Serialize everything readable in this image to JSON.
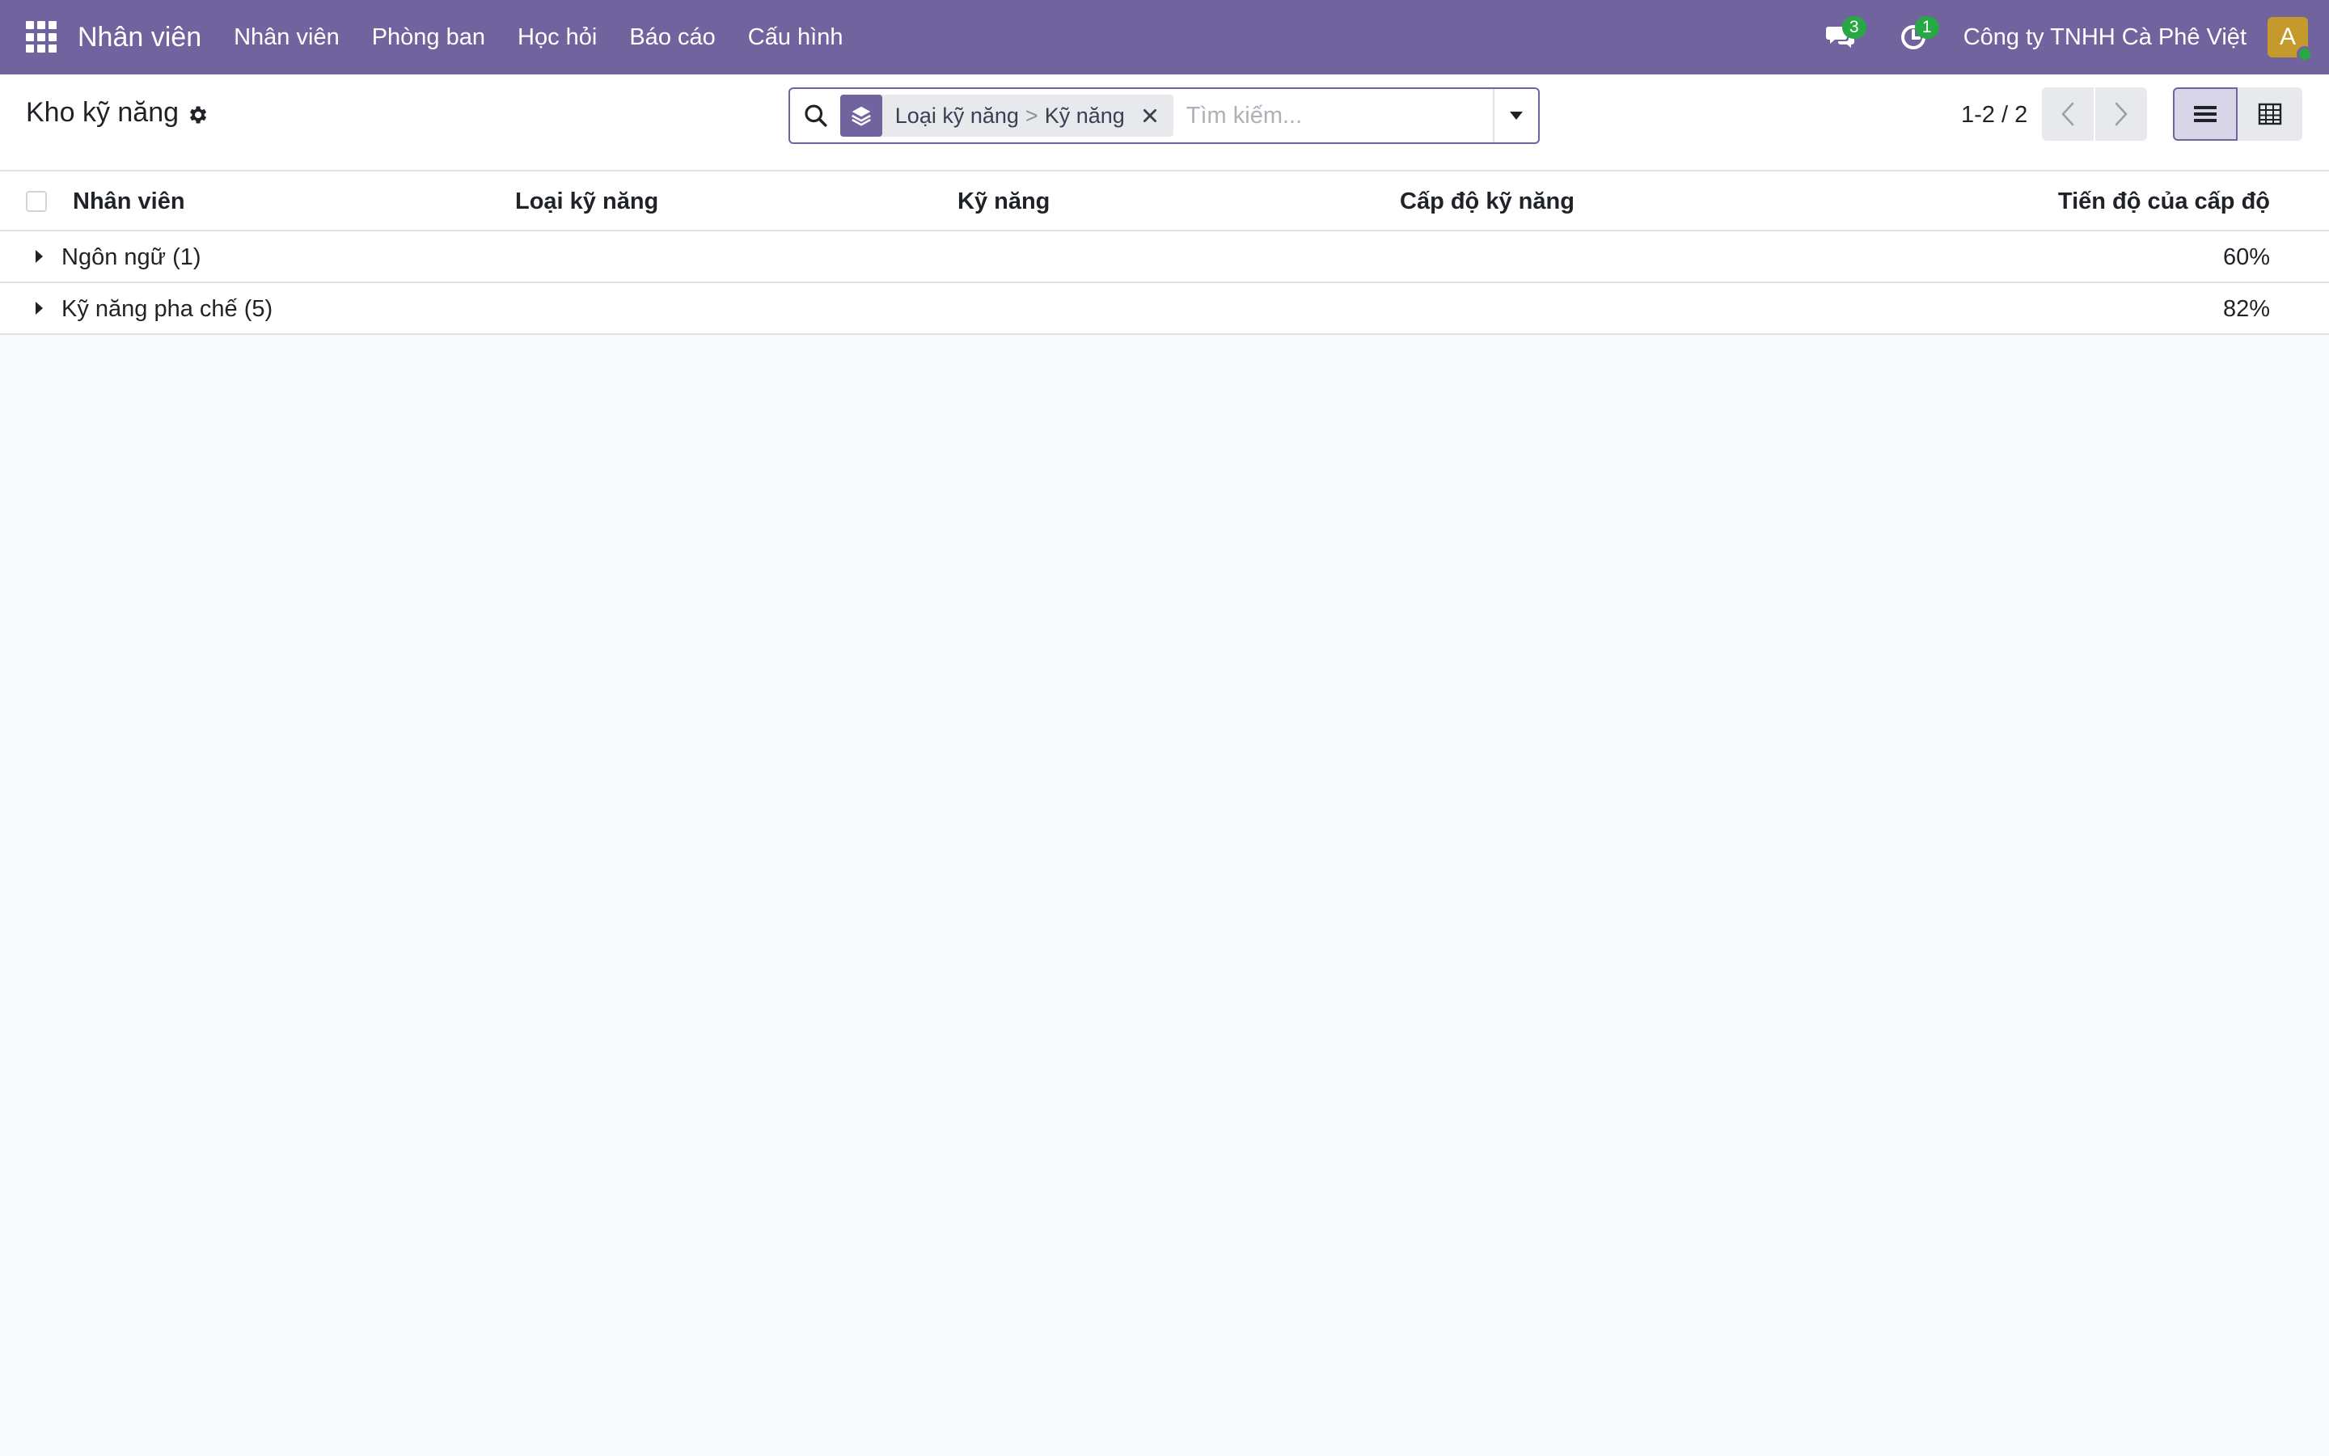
{
  "navbar": {
    "app_name": "Nhân viên",
    "menu": [
      "Nhân viên",
      "Phòng ban",
      "Học hỏi",
      "Báo cáo",
      "Cấu hình"
    ],
    "messages_count": "3",
    "activities_count": "1",
    "company": "Công ty TNHH Cà Phê Việt",
    "avatar_letter": "A"
  },
  "control_panel": {
    "title": "Kho kỹ năng",
    "facet": {
      "group_1": "Loại kỹ năng",
      "separator": ">",
      "group_2": "Kỹ năng"
    },
    "search_placeholder": "Tìm kiếm...",
    "pager": "1-2 / 2"
  },
  "table": {
    "columns": [
      "Nhân viên",
      "Loại kỹ năng",
      "Kỹ năng",
      "Cấp độ kỹ năng",
      "Tiến độ của cấp độ"
    ],
    "groups": [
      {
        "name": "Ngôn ngữ (1)",
        "progress": "60%"
      },
      {
        "name": "Kỹ năng pha chế (5)",
        "progress": "82%"
      }
    ]
  },
  "colors": {
    "brand": "#71639e",
    "badge": "#28a745",
    "avatar": "#c59a2c"
  },
  "icons": [
    "apps-grid-icon",
    "chat-bubbles-icon",
    "clock-activity-icon",
    "gear-icon",
    "search-icon",
    "layers-icon",
    "close-icon",
    "caret-down-icon",
    "chevron-left-icon",
    "chevron-right-icon",
    "list-view-icon",
    "pivot-table-icon",
    "caret-right-icon"
  ]
}
